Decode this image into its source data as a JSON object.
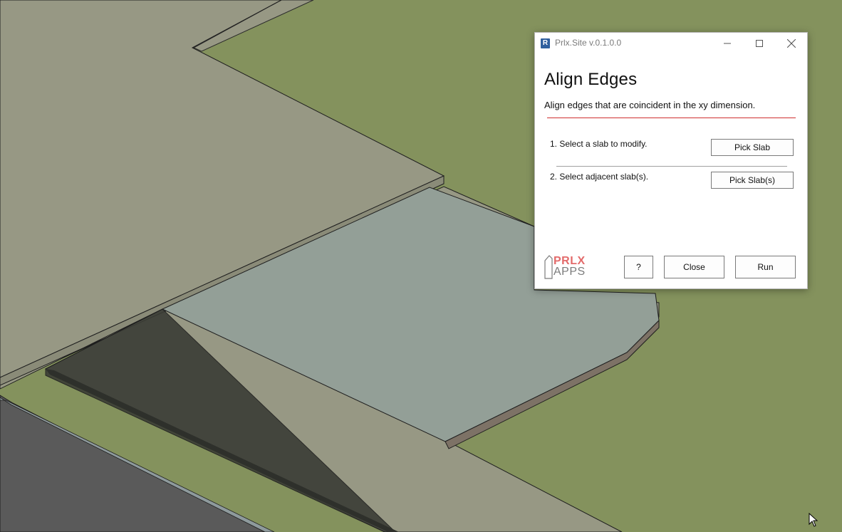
{
  "window": {
    "title": "Prlx.Site v.0.1.0.0",
    "app_icon_letter": "R"
  },
  "dialog": {
    "heading": "Align Edges",
    "subtitle": "Align edges that are coincident in the xy dimension.",
    "steps": [
      {
        "label": "1. Select a slab to modify.",
        "button": "Pick Slab"
      },
      {
        "label": "2. Select adjacent slab(s).",
        "button": "Pick Slab(s)"
      }
    ],
    "logo": {
      "line1": "PRLX",
      "line2": "APPS"
    },
    "footer": {
      "help": "?",
      "close": "Close",
      "run": "Run"
    }
  },
  "colors": {
    "ground": "#84925d",
    "slab_top": "#979884",
    "selected_slab": "#939f97",
    "accent_rule": "#d03030",
    "logo_accent": "#e36b6b"
  },
  "icons": [
    "app-icon",
    "minimize-icon",
    "maximize-icon",
    "close-icon",
    "cursor-icon"
  ]
}
